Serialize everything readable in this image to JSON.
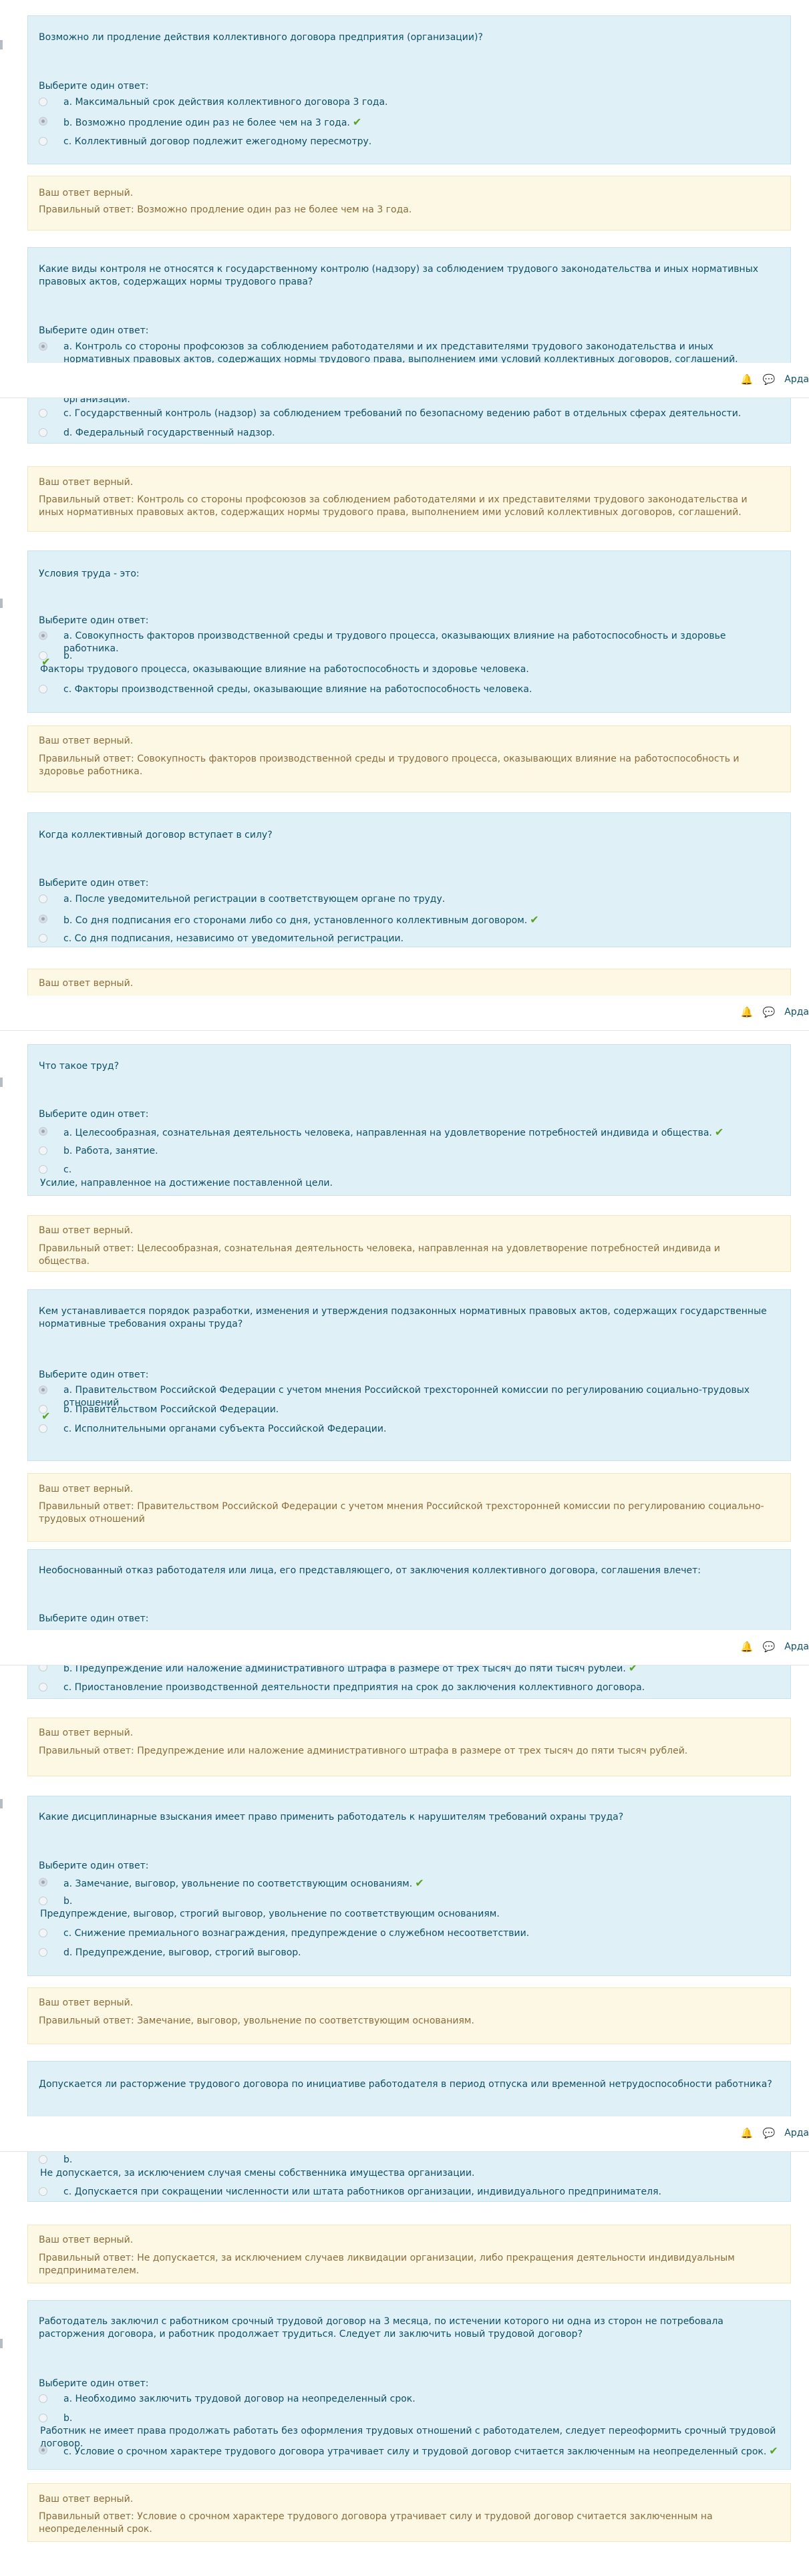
{
  "questions": [
    {
      "text": "Возможно ли продление действия коллективного договора предприятия (организации)?",
      "prompt": "Выберите один ответ:",
      "options": [
        "a. Максимальный срок действия коллективного договора 3 года.",
        "b. Возможно продление один раз не более чем на 3 года.",
        "c. Коллективный договор подлежит ежегодному пересмотру."
      ],
      "feedback_title": "Ваш ответ верный.",
      "feedback_answer": "Правильный ответ: Возможно продление один раз не более чем на 3 года."
    },
    {
      "text": "Какие виды контроля не относятся к государственному контролю (надзору) за соблюдением трудового законодательства и иных нормативных правовых актов, содержащих нормы трудового права?",
      "prompt": "Выберите один ответ:",
      "options": [
        "a. Контроль со стороны профсоюзов за соблюдением работодателями и их представителями трудового законодательства и иных нормативных правовых актов, содержащих нормы трудового права, выполнением ими условий коллективных договоров, соглашений.",
        "организации.",
        "c. Государственный контроль (надзор) за соблюдением требований по безопасному ведению работ в отдельных сферах деятельности.",
        "d. Федеральный государственный надзор."
      ],
      "feedback_title": "Ваш ответ верный.",
      "feedback_answer": "Правильный ответ: Контроль со стороны профсоюзов за соблюдением работодателями и их представителями трудового законодательства и иных нормативных правовых актов, содержащих нормы трудового права, выполнением ими условий коллективных договоров, соглашений."
    },
    {
      "text": "Условия труда - это:",
      "prompt": "Выберите один ответ:",
      "options": [
        "a. Совокупность факторов производственной среды и трудового процесса, оказывающих влияние на работоспособность и здоровье работника.",
        "b.",
        "Факторы трудового процесса, оказывающие влияние на работоспособность и здоровье человека.",
        "c. Факторы производственной среды, оказывающие влияние на работоспособность человека."
      ],
      "feedback_title": "Ваш ответ верный.",
      "feedback_answer": "Правильный ответ: Совокупность факторов производственной среды и трудового процесса, оказывающих влияние на работоспособность и здоровье работника."
    },
    {
      "text": "Когда коллективный договор вступает в силу?",
      "prompt": "Выберите один ответ:",
      "options": [
        "a. После уведомительной регистрации в соответствующем органе по труду.",
        "b. Со дня подписания его сторонами либо со дня, установленного коллективным договором.",
        "c. Со дня подписания, независимо от уведомительной регистрации."
      ],
      "feedback_title": "Ваш ответ верный."
    },
    {
      "text": "Что такое труд?",
      "prompt": "Выберите один ответ:",
      "options": [
        "a. Целесообразная, сознательная деятельность человека, направленная на удовлетворение потребностей индивида и общества.",
        "b. Работа, занятие.",
        "c.",
        "Усилие, направленное на достижение поставленной цели."
      ],
      "feedback_title": "Ваш ответ верный.",
      "feedback_answer": "Правильный ответ: Целесообразная, сознательная деятельность человека, направленная на удовлетворение потребностей индивида и общества."
    },
    {
      "text": "Кем устанавливается порядок разработки, изменения и утверждения подзаконных нормативных правовых актов, содержащих государственные нормативные требования охраны труда?",
      "prompt": "Выберите один ответ:",
      "options": [
        "a. Правительством Российской Федерации с учетом мнения Российской трехсторонней комиссии по регулированию социально-трудовых отношений",
        "b. Правительством Российской Федерации.",
        "c. Исполнительными органами субъекта Российской Федерации."
      ],
      "feedback_title": "Ваш ответ верный.",
      "feedback_answer": "Правильный ответ: Правительством Российской Федерации с учетом мнения Российской трехсторонней комиссии по регулированию социально-трудовых отношений"
    },
    {
      "text": "Необоснованный отказ работодателя или лица, его представляющего, от заключения коллективного договора, соглашения влечет:",
      "prompt": "Выберите один ответ:",
      "options": [
        "b. Предупреждение или наложение административного штрафа в размере от трех тысяч до пяти тысяч рублей.",
        "c. Приостановление производственной деятельности предприятия на срок до заключения коллективного договора."
      ],
      "feedback_title": "Ваш ответ верный.",
      "feedback_answer": "Правильный ответ: Предупреждение или наложение административного штрафа в размере от трех тысяч до пяти тысяч рублей."
    },
    {
      "text": "Какие дисциплинарные взыскания имеет право применить работодатель к нарушителям требований охраны труда?",
      "prompt": "Выберите один ответ:",
      "options": [
        "a. Замечание, выговор, увольнение по соответствующим основаниям.",
        "b.",
        "Предупреждение, выговор, строгий выговор, увольнение по соответствующим основаниям.",
        "c. Снижение премиального вознаграждения, предупреждение о служебном несоответствии.",
        "d. Предупреждение, выговор, строгий выговор."
      ],
      "feedback_title": "Ваш ответ верный.",
      "feedback_answer": "Правильный ответ: Замечание, выговор, увольнение по соответствующим основаниям."
    },
    {
      "text": "Допускается ли расторжение трудового договора по инициативе работодателя в период отпуска или временной нетрудоспособности работника?",
      "options": [
        "b.",
        "Не допускается, за исключением случая смены собственника имущества организации.",
        "c. Допускается при сокращении численности или штата работников организации, индивидуального предпринимателя."
      ],
      "feedback_title": "Ваш ответ верный.",
      "feedback_answer": "Правильный ответ: Не допускается, за исключением случаев ликвидации организации, либо прекращения деятельности индивидуальным предпринимателем."
    },
    {
      "text": "Работодатель заключил с работником срочный трудовой договор на 3 месяца, по истечении которого ни одна из сторон не потребовала расторжения договора, и работник продолжает трудиться. Следует ли заключить новый трудовой договор?",
      "prompt": "Выберите один ответ:",
      "options": [
        "a. Необходимо заключить трудовой договор на неопределенный срок.",
        "b.",
        "Работник не имеет права продолжать работать без оформления трудовых отношений с работодателем, следует переоформить срочный трудовой договор.",
        "c. Условие о срочном характере трудового договора утрачивает силу и трудовой договор считается заключенным на неопределенный срок."
      ],
      "feedback_title": "Ваш ответ верный.",
      "feedback_answer": "Правильный ответ: Условие о срочном характере трудового договора утрачивает силу и трудовой договор считается заключенным на неопределенный срок."
    }
  ],
  "navbar": {
    "bell_icon": "bell-icon",
    "chat_icon": "chat-icon",
    "user_label": "Арда"
  },
  "colors": {
    "question_bg": "#dff0f7",
    "feedback_bg": "#fcf8e3",
    "check": "#5aa125"
  }
}
